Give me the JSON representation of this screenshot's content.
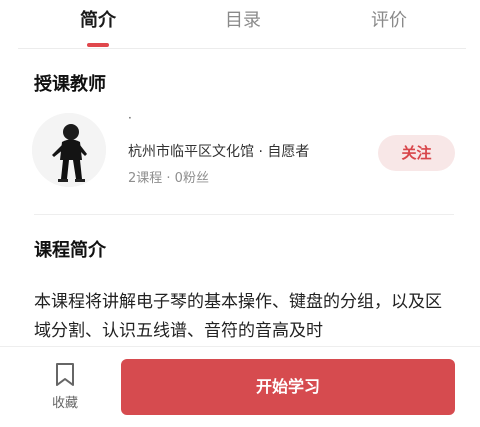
{
  "tabs": [
    {
      "label": "简介",
      "active": true
    },
    {
      "label": "目录",
      "active": false
    },
    {
      "label": "评价",
      "active": false
    }
  ],
  "teacher_section": {
    "title": "授课教师",
    "name": "·",
    "description": "杭州市临平区文化馆 · 自愿者",
    "stats": "2课程 · 0粉丝",
    "follow_label": "关注"
  },
  "intro_section": {
    "title": "课程简介",
    "text": "本课程将讲解电子琴的基本操作、键盘的分组，以及区域分割、认识五线谱、音符的音高及时"
  },
  "bottom_bar": {
    "favorite_label": "收藏",
    "start_label": "开始学习"
  },
  "colors": {
    "accent": "#d64b4f",
    "follow_bg": "#f8e7e7"
  }
}
